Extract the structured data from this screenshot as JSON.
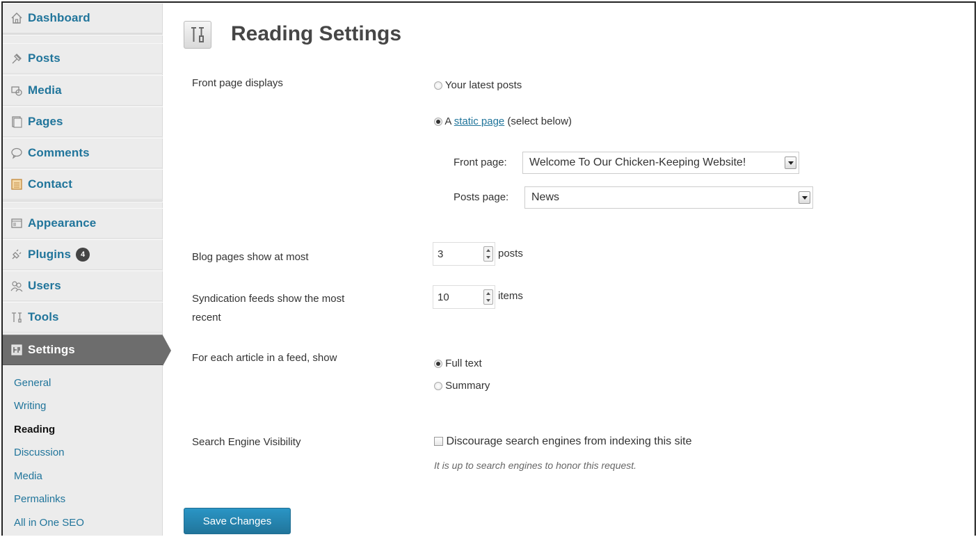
{
  "sidebar": {
    "items": [
      {
        "label": "Dashboard",
        "icon": "home-icon"
      },
      {
        "label": "Posts",
        "icon": "pin-icon"
      },
      {
        "label": "Media",
        "icon": "media-icon"
      },
      {
        "label": "Pages",
        "icon": "pages-icon"
      },
      {
        "label": "Comments",
        "icon": "comment-icon"
      },
      {
        "label": "Contact",
        "icon": "contact-icon"
      },
      {
        "label": "Appearance",
        "icon": "appearance-icon"
      },
      {
        "label": "Plugins",
        "icon": "plugin-icon",
        "badge": "4"
      },
      {
        "label": "Users",
        "icon": "users-icon"
      },
      {
        "label": "Tools",
        "icon": "tools-icon"
      },
      {
        "label": "Settings",
        "icon": "settings-icon"
      }
    ],
    "submenu": [
      "General",
      "Writing",
      "Reading",
      "Discussion",
      "Media",
      "Permalinks",
      "All in One SEO"
    ],
    "current_submenu": "Reading"
  },
  "page": {
    "title": "Reading Settings"
  },
  "front_page": {
    "label": "Front page displays",
    "option_latest": "Your latest posts",
    "option_static_prefix": "A",
    "option_static_link": "static page",
    "option_static_suffix": "(select below)",
    "selected": "static",
    "front_page_label": "Front page:",
    "front_page_value": "Welcome To Our Chicken-Keeping Website!",
    "posts_page_label": "Posts page:",
    "posts_page_value": "News"
  },
  "blog_pages": {
    "label": "Blog pages show at most",
    "value": "3",
    "unit": "posts"
  },
  "syndication": {
    "label_line1": "Syndication feeds show the most",
    "label_line2": "recent",
    "value": "10",
    "unit": "items"
  },
  "feed_article": {
    "label": "For each article in a feed, show",
    "option_full": "Full text",
    "option_summary": "Summary",
    "selected": "full"
  },
  "search_visibility": {
    "label": "Search Engine Visibility",
    "checkbox_label": "Discourage search engines from indexing this site",
    "checked": false,
    "description": "It is up to search engines to honor this request."
  },
  "actions": {
    "save_label": "Save Changes"
  },
  "colors": {
    "link": "#21759b",
    "active_menu": "#6d6d6d",
    "button": "#21759b"
  }
}
